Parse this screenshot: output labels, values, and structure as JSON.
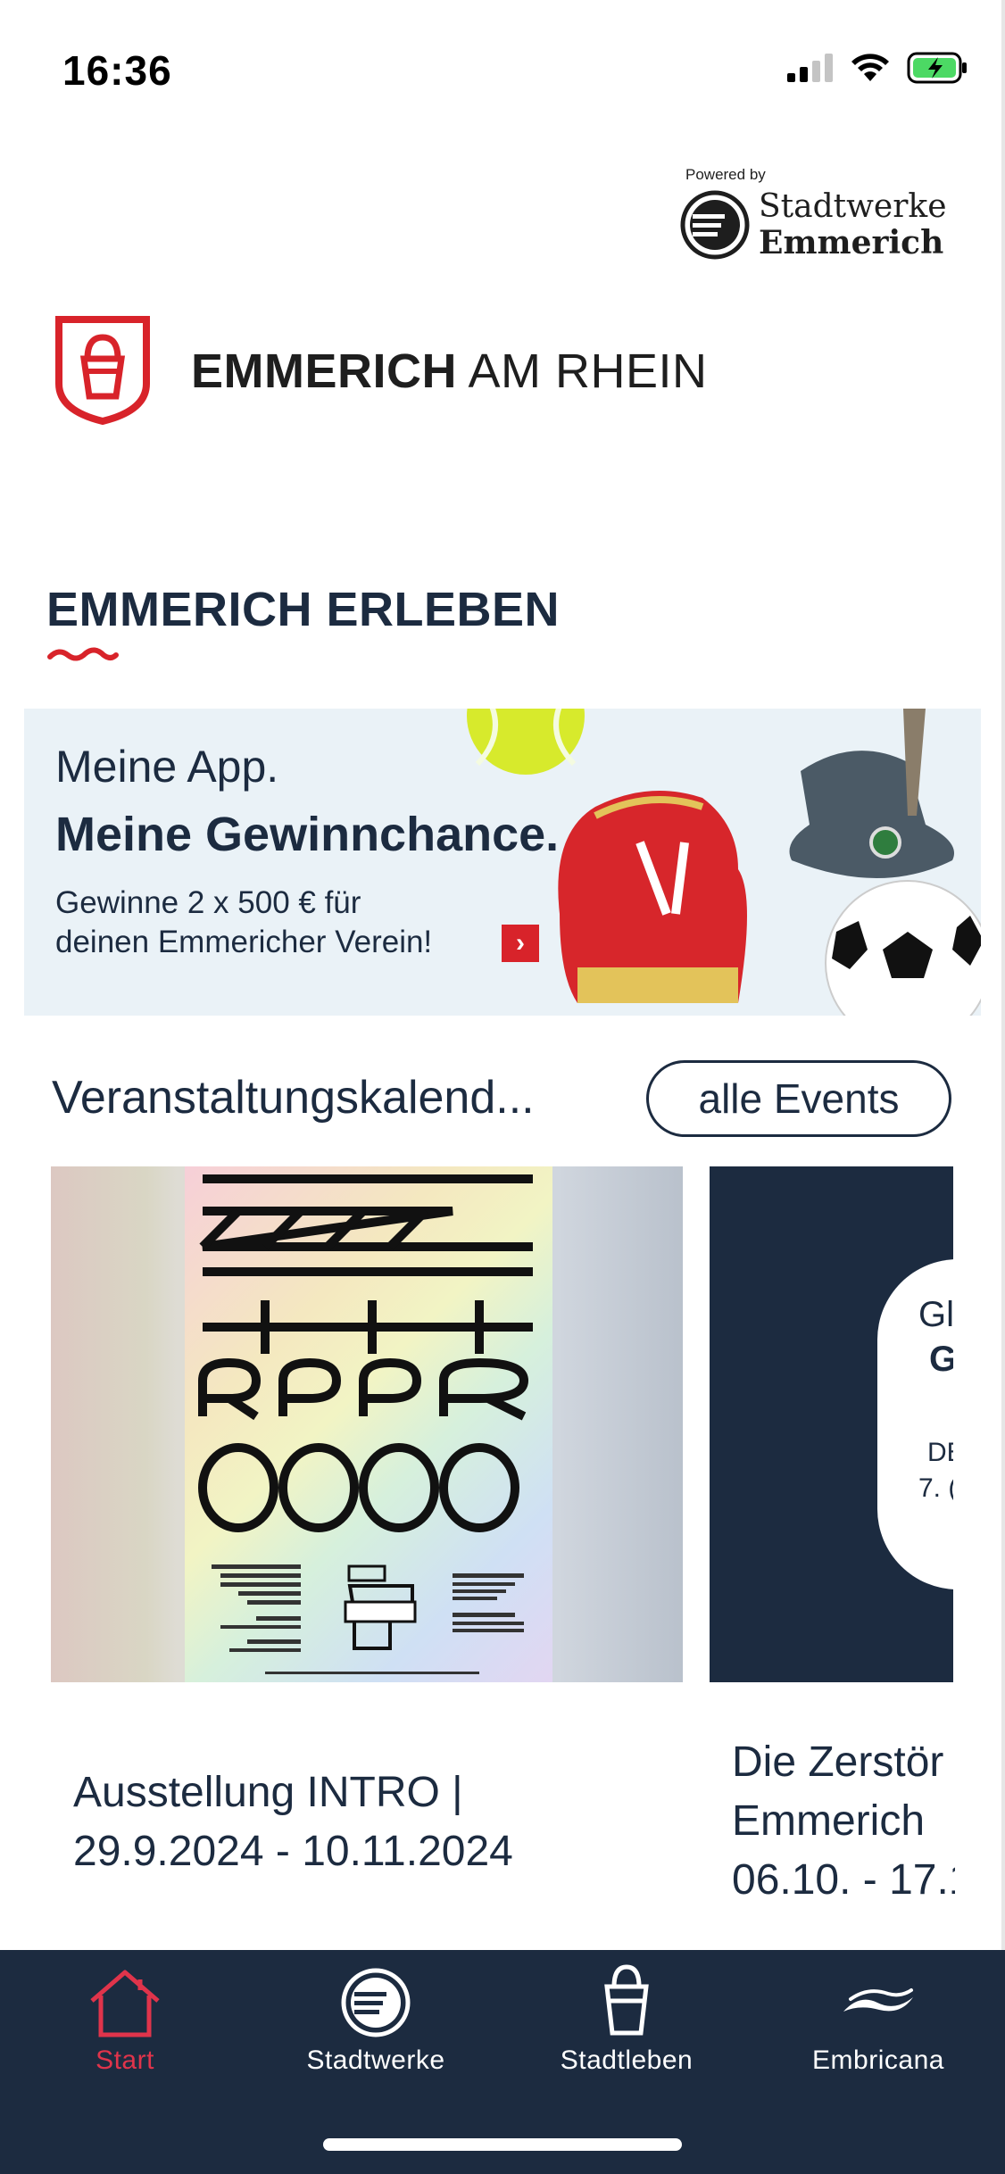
{
  "status_bar": {
    "time": "16:36"
  },
  "header": {
    "powered_by": "Powered by",
    "partner_line1": "Stadtwerke",
    "partner_line2": "Emmerich",
    "city_bold": "EMMERICH",
    "city_rest": "AM RHEIN"
  },
  "section": {
    "title": "EMMERICH ERLEBEN"
  },
  "banner": {
    "line1": "Meine App.",
    "line2": "Meine Gewinnchance.",
    "line3": "Gewinne 2 x 500 € für",
    "line4": "deinen Emmericher Verein!"
  },
  "events": {
    "title": "Veranstaltungskalend...",
    "all_label": "alle Events",
    "cards": [
      {
        "line1": "Ausstellung INTRO |",
        "line2": "29.9.2024 - 10.11.2024"
      },
      {
        "line1": "Die Zerstör",
        "line2": "Emmerich",
        "line3": "06.10. - 17.1",
        "poster_a": "Gl",
        "poster_b": "G",
        "poster_c": "DE",
        "poster_d": "7. ("
      }
    ]
  },
  "tabbar": {
    "tabs": [
      {
        "label": "Start",
        "icon": "home-icon",
        "active": true
      },
      {
        "label": "Stadtwerke",
        "icon": "stadtwerke-icon",
        "active": false
      },
      {
        "label": "Stadtleben",
        "icon": "bag-icon",
        "active": false
      },
      {
        "label": "Embricana",
        "icon": "wave-icon",
        "active": false
      }
    ]
  },
  "colors": {
    "navy": "#1c2b40",
    "accent_red": "#e0344b",
    "banner_bg": "#eaf2f7"
  }
}
